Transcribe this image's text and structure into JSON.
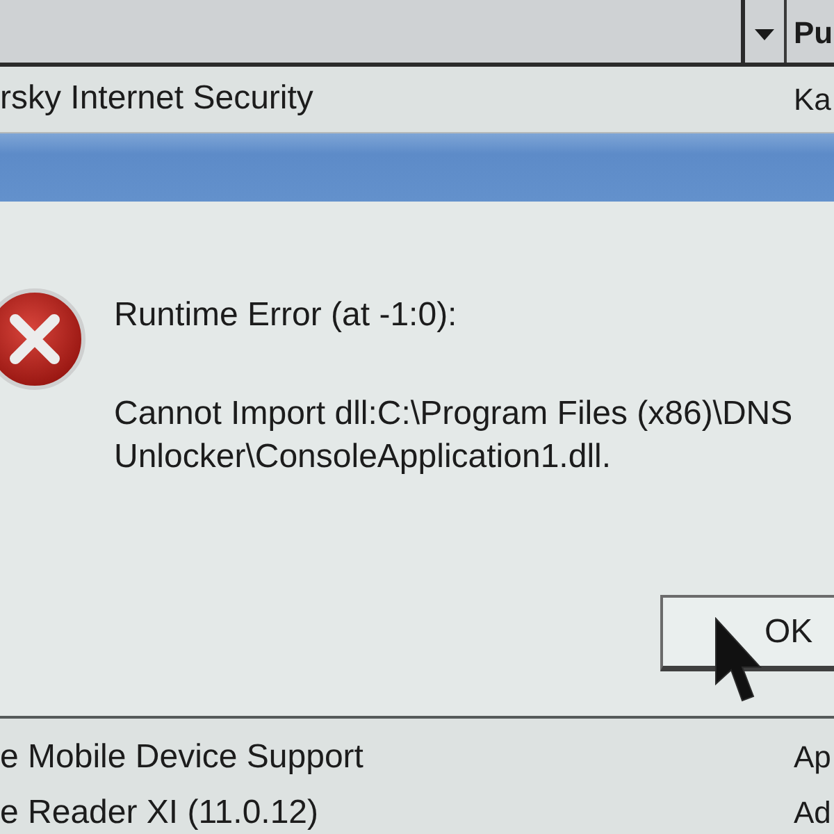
{
  "program_list_top": {
    "header_column_2": "Pu",
    "rows": [
      {
        "column_1": "rsky Internet Security",
        "column_2": "Ka"
      }
    ]
  },
  "dialog": {
    "title": "Runtime Error (at -1:0):",
    "message": "Cannot Import dll:C:\\Program Files (x86)\\DNS Unlocker\\ConsoleApplication1.dll.",
    "buttons": [
      {
        "label": "OK"
      }
    ]
  },
  "program_list_bottom": {
    "rows": [
      {
        "column_1": "e Mobile Device Support",
        "column_2": "Ap"
      },
      {
        "column_1": "e Reader XI (11.0.12)",
        "column_2": "Ad"
      }
    ]
  }
}
